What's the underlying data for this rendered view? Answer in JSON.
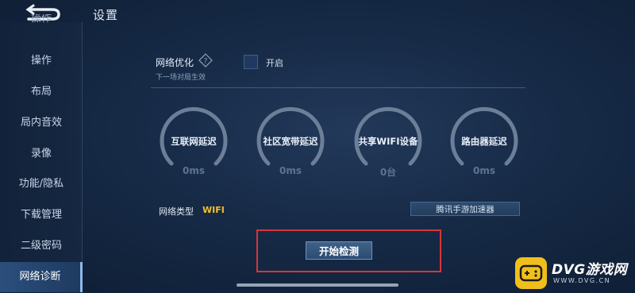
{
  "header": {
    "back_icon": "back-arrow-icon",
    "title": "设置"
  },
  "sidebar": {
    "partial_item": "操作",
    "items": [
      {
        "label": "操作",
        "active": false
      },
      {
        "label": "布局",
        "active": false
      },
      {
        "label": "局内音效",
        "active": false
      },
      {
        "label": "录像",
        "active": false
      },
      {
        "label": "功能/隐私",
        "active": false
      },
      {
        "label": "下载管理",
        "active": false
      },
      {
        "label": "二级密码",
        "active": false
      },
      {
        "label": "网络诊断",
        "active": true
      }
    ]
  },
  "network_optimization": {
    "label": "网络优化",
    "help_icon": "question-icon",
    "subtitle": "下一场对局生效",
    "toggle_label": "开启",
    "checked": false
  },
  "gauges": [
    {
      "label": "互联网延迟",
      "value": "0ms"
    },
    {
      "label": "社区宽带延迟",
      "value": "0ms"
    },
    {
      "label": "共享WIFI设备",
      "value": "0台"
    },
    {
      "label": "路由器延迟",
      "value": "0ms"
    }
  ],
  "network_type": {
    "label": "网络类型",
    "value": "WIFI",
    "value_color": "#f2c030"
  },
  "accelerator_button": "腾讯手游加速器",
  "start_button": "开始检测",
  "watermark": {
    "title": "DVG游戏网",
    "url": "WWW.DVG.CN"
  },
  "colors": {
    "highlight": "#d8353b",
    "accent": "#f2c030"
  }
}
